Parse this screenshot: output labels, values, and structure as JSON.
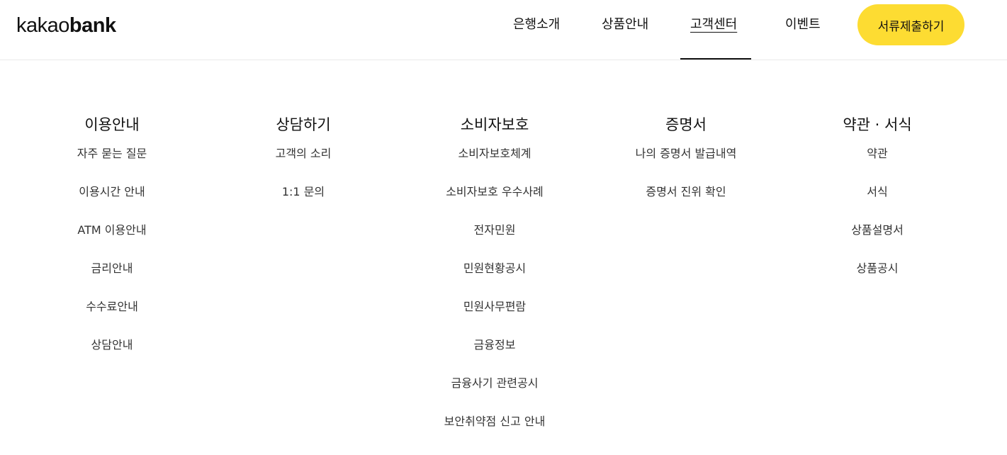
{
  "header": {
    "logo_light": "kakao",
    "logo_bold": "bank",
    "nav": [
      {
        "label": "은행소개"
      },
      {
        "label": "상품안내"
      },
      {
        "label": "고객센터"
      },
      {
        "label": "이벤트"
      }
    ],
    "active_nav": "고객센터",
    "cta_label": "서류제출하기",
    "cta_color": "#fddc32"
  },
  "menu": {
    "columns": [
      {
        "title": "이용안내",
        "items": [
          "자주 묻는 질문",
          "이용시간 안내",
          "ATM 이용안내",
          "금리안내",
          "수수료안내",
          "상담안내"
        ]
      },
      {
        "title": "상담하기",
        "items": [
          "고객의 소리",
          "1:1 문의"
        ]
      },
      {
        "title": "소비자보호",
        "items": [
          "소비자보호체계",
          "소비자보호 우수사례",
          "전자민원",
          "민원현황공시",
          "민원사무편람",
          "금융정보",
          "금융사기 관련공시",
          "보안취약점 신고 안내"
        ]
      },
      {
        "title": "증명서",
        "items": [
          "나의 증명서 발급내역",
          "증명서 진위 확인"
        ]
      },
      {
        "title": "약관 · 서식",
        "items": [
          "약관",
          "서식",
          "상품설명서",
          "상품공시"
        ]
      }
    ]
  }
}
